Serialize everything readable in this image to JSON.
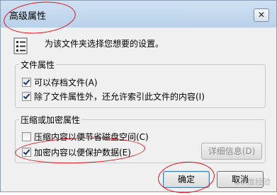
{
  "dialog": {
    "title": "高级属性",
    "close_label": "✕",
    "description": "为该文件夹选择您想要的设置。"
  },
  "file_attributes": {
    "group_label": "文件属性",
    "archive": {
      "label": "可以存档文件(A)",
      "checked": true
    },
    "index": {
      "label": "除了文件属性外，还允许索引此文件的内容(I)",
      "checked": true
    }
  },
  "compress_encrypt": {
    "group_label": "压缩或加密属性",
    "compress": {
      "label": "压缩内容以便节省磁盘空间(C)",
      "checked": false
    },
    "encrypt": {
      "label": "加密内容以便保护数据(E)",
      "checked": true
    },
    "details_label": "详细信息(D)"
  },
  "buttons": {
    "ok_label": "确定",
    "cancel_label": "取消"
  },
  "watermark": "Bai度经验",
  "colors": {
    "annotation": "#e01020",
    "titlebar": "#c4d8ef"
  }
}
